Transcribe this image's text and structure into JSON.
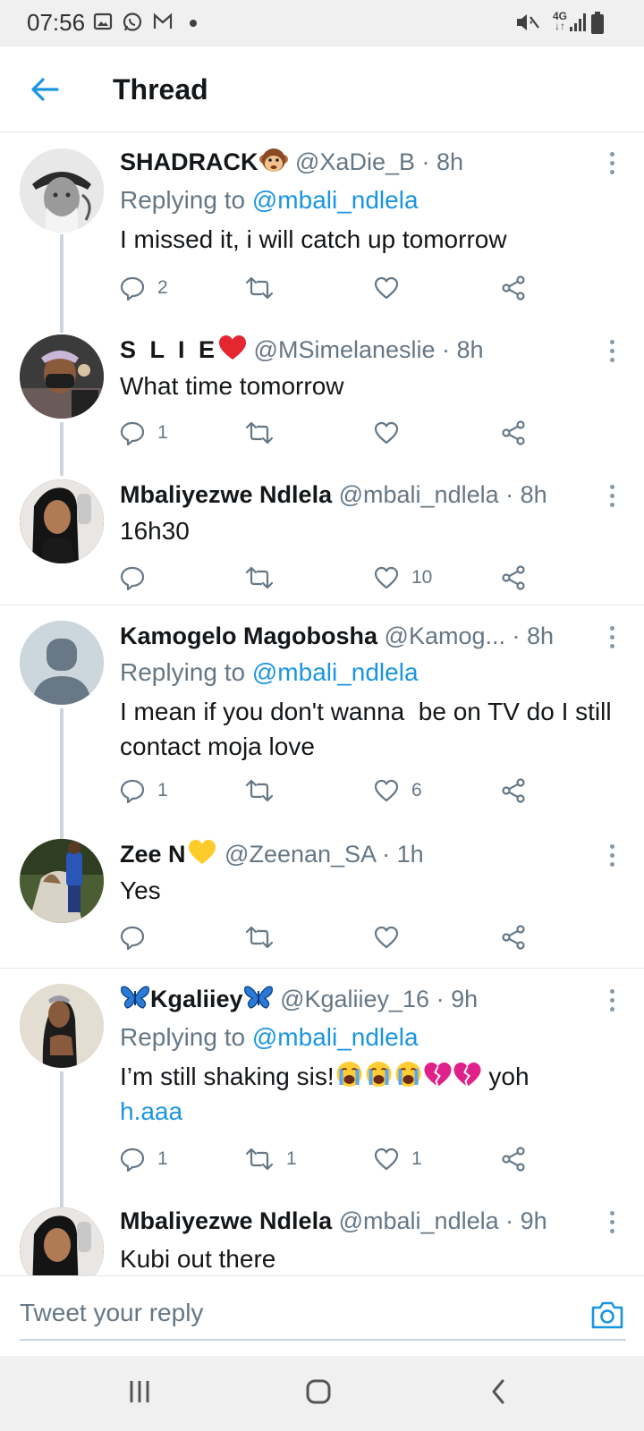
{
  "status_bar": {
    "time": "07:56",
    "icons": [
      "gallery-icon",
      "whatsapp-icon",
      "gmail-icon",
      "dot-icon",
      "mute-icon",
      "4g-icon",
      "signal-icon",
      "battery-icon"
    ],
    "network": "4G"
  },
  "header": {
    "title": "Thread",
    "back_icon": "arrow-left-icon"
  },
  "colors": {
    "accent": "#1b95e0",
    "muted": "#657786",
    "text": "#14171a",
    "divider": "#e1e8ed"
  },
  "tweets": [
    {
      "name": "SHADRACK",
      "name_emoji": "monkey-face",
      "handle": "@XaDie_B",
      "time": "· 8h",
      "replying_prefix": "Replying to",
      "replying_to": "@mbali_ndlela",
      "text": "I missed it, i will catch up tomorrow",
      "replies": "2",
      "retweets": "",
      "likes": ""
    },
    {
      "name": "S L I E",
      "name_emoji": "red-heart",
      "handle": "@MSimelaneslie",
      "time": "· 8h",
      "text": "What time tomorrow",
      "replies": "1",
      "retweets": "",
      "likes": ""
    },
    {
      "name": "Mbaliyezwe Ndlela",
      "handle": "@mbali_ndlela",
      "time": "· 8h",
      "text": "16h30",
      "replies": "",
      "retweets": "",
      "likes": "10"
    },
    {
      "name": "Kamogelo Magobosha",
      "handle": "@Kamog...",
      "time": "· 8h",
      "replying_prefix": "Replying to",
      "replying_to": "@mbali_ndlela",
      "text": "I mean if you don't wanna  be on TV do I still contact moja love",
      "replies": "1",
      "retweets": "",
      "likes": "6"
    },
    {
      "name": "Zee N",
      "name_emoji": "yellow-heart",
      "handle": "@Zeenan_SA",
      "time": "· 1h",
      "text": "Yes",
      "replies": "",
      "retweets": "",
      "likes": ""
    },
    {
      "name": "Kgaliiey",
      "name_emoji": "butterfly",
      "handle": "@Kgaliiey_16",
      "time": "· 9h",
      "replying_prefix": "Replying to",
      "replying_to": "@mbali_ndlela",
      "text": "I’m still shaking sis!",
      "text_emojis": [
        "loudly-crying-face",
        "loudly-crying-face",
        "loudly-crying-face",
        "broken-heart",
        "broken-heart"
      ],
      "text_after": " yoh",
      "link": "h.aaa",
      "replies": "1",
      "retweets": "1",
      "likes": "1"
    },
    {
      "name": "Mbaliyezwe Ndlela",
      "handle": "@mbali_ndlela",
      "time": "· 9h",
      "text": "Kubi out there"
    }
  ],
  "reply_bar": {
    "placeholder": "Tweet your reply",
    "camera_icon": "camera-icon"
  },
  "nav_bar": {
    "icons": [
      "recent-apps-icon",
      "home-icon",
      "back-icon"
    ]
  }
}
